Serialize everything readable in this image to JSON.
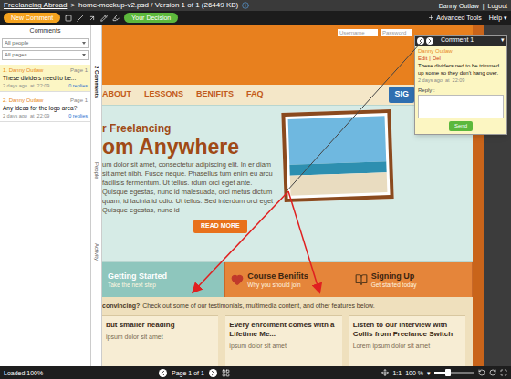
{
  "breadcrumb": {
    "project": "Freelancing Abroad",
    "separator": ">",
    "file": "home-mockup-v2.psd / Version 1 of 1 (26449 KB)"
  },
  "user": {
    "name": "Danny Outlaw",
    "separator": "|",
    "logout": "Logout"
  },
  "toolbar": {
    "new_comment": "New Comment",
    "decision": "Your Decision",
    "advanced": "Advanced Tools",
    "help": "Help ▾"
  },
  "comments_panel": {
    "title": "Comments",
    "filters": [
      {
        "value": "All people"
      },
      {
        "value": "All pages"
      }
    ],
    "items": [
      {
        "author": "1. Danny Outlaw",
        "page": "Page 1",
        "text": "These dividers need to be...",
        "time": "2 days ago  at  22:09",
        "replies": "0 replies",
        "selected": true
      },
      {
        "author": "2. Danny Outlaw",
        "page": "Page 1",
        "text": "Any ideas for the logo area?",
        "time": "2 days ago  at  22:09",
        "replies": "0 replies",
        "selected": false
      }
    ]
  },
  "side_tabs": [
    {
      "label": "2 Comments",
      "selected": true
    },
    {
      "label": "People",
      "selected": false
    },
    {
      "label": "Activity",
      "selected": false
    }
  ],
  "mockup": {
    "login": {
      "username": "Username",
      "password": "Password"
    },
    "nav": [
      "ABOUT",
      "LESSONS",
      "BENIFITS",
      "FAQ"
    ],
    "nav_button": "SIG",
    "hero_kicker": "r Freelancing",
    "hero_title": "om Anywhere",
    "hero_body": "um dolor sit amet, consectetur adipiscing elit. In er diam sit amet nibh. Fusce neque. Phasellus tum enim eu arcu facilisis fermentum. Ut tellus. rdum orci eget ante. Quisque egestas, nunc id malesuada, orci metus dictum quam, id lacinia id odio.  Ut tellus. Sed interdum orci eget Quisque egestas, nunc id",
    "read_more": "READ MORE",
    "features": [
      {
        "title": "Getting Started",
        "subtitle": "Take the next step",
        "selected": true
      },
      {
        "title": "Course Benifits",
        "subtitle": "Why you should join",
        "selected": false
      },
      {
        "title": "Signing Up",
        "subtitle": "Get started today",
        "selected": false
      }
    ],
    "convincing": "convincing?",
    "convincing_rest": "Check out some of our testimonials, multimedia content, and other features below.",
    "columns": [
      {
        "heading": "but smaller heading",
        "body": "ipsum dolor sit amet"
      },
      {
        "heading": "Every enrolment comes with a Lifetime Me...",
        "body": "ipsum dolor sit amet"
      },
      {
        "heading": "Listen to our interview with Collis from Freelance Switch",
        "body": "Lorem ipsum dolor sit amet"
      }
    ]
  },
  "comment_popup": {
    "title": "Comment 1",
    "menu": "▾",
    "author": "Danny Outlaw",
    "edit": "Edit",
    "separator": "|",
    "delete": "Del",
    "text": "These dividers ned to be trimmed up some so they don't hang over.",
    "time": "2 days ago  at  22:09",
    "reply_label": "Reply :",
    "send": "Send"
  },
  "status_bar": {
    "loaded": "Loaded 100%",
    "page": "Page 1 of 1",
    "ratio": "1:1",
    "zoom": "100 %",
    "zoom_menu": "▾",
    "zoom_level": 0.35
  }
}
